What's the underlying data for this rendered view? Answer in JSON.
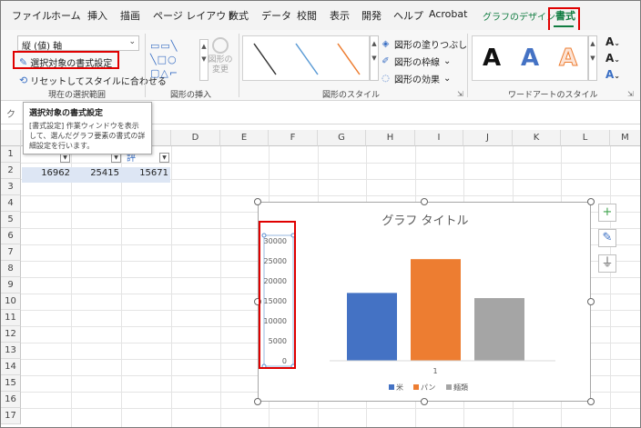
{
  "menu": {
    "tabs": [
      {
        "label": "ファイル"
      },
      {
        "label": "ホーム"
      },
      {
        "label": "挿入"
      },
      {
        "label": "描画"
      },
      {
        "label": "ページ レイアウト"
      },
      {
        "label": "数式"
      },
      {
        "label": "データ"
      },
      {
        "label": "校閲"
      },
      {
        "label": "表示"
      },
      {
        "label": "開発"
      },
      {
        "label": "ヘルプ"
      },
      {
        "label": "Acrobat"
      },
      {
        "label": "グラフのデザイン"
      },
      {
        "label": "書式"
      }
    ],
    "active_tab": "書式"
  },
  "ribbon": {
    "selection_group": {
      "element_combo": "縦 (値) 軸",
      "format_selection": "選択対象の書式設定",
      "reset_style": "リセットしてスタイルに合わせる",
      "label": "現在の選択範囲"
    },
    "insert_shapes": {
      "change_shape": "図形の変更",
      "label": "図形の挿入"
    },
    "shape_styles": {
      "fill": "図形の塗りつぶし",
      "outline": "図形の枠線",
      "effects": "図形の効果",
      "label": "図形のスタイル",
      "colors": {
        "line1": "#333333",
        "line2": "#5b9bd5",
        "line3": "#ed7d31"
      }
    },
    "wordart": {
      "letters": [
        "A",
        "A",
        "A"
      ],
      "label": "ワードアートのスタイル",
      "colors": {
        "letter1": "#111111",
        "letter2": "#4472c4",
        "letter3": "#ed7d31"
      }
    }
  },
  "tooltip": {
    "title": "選択対象の書式設定",
    "body": "[書式設定] 作業ウィンドウを表示して、選んだグラフ要素の書式の詳細設定を行います。"
  },
  "sheet": {
    "columns": [
      "D",
      "E",
      "F",
      "G",
      "H",
      "I",
      "J",
      "K",
      "L",
      "M"
    ],
    "rows": [
      "1",
      "2",
      "3",
      "4",
      "5",
      "6",
      "7",
      "8",
      "9",
      "10",
      "11",
      "12",
      "13",
      "14",
      "15",
      "16",
      "17"
    ],
    "header_fragment": "評",
    "row2_values": [
      "16962",
      "25415",
      "15671"
    ]
  },
  "chart_data": {
    "type": "bar",
    "title": "グラフ タイトル",
    "categories": [
      "1"
    ],
    "series": [
      {
        "name": "米",
        "values": [
          16962
        ],
        "color": "#4472c4"
      },
      {
        "name": "パン",
        "values": [
          25415
        ],
        "color": "#ed7d31"
      },
      {
        "name": "麺類",
        "values": [
          15671
        ],
        "color": "#a5a5a5"
      }
    ],
    "ylim": [
      0,
      30000
    ],
    "yticks": [
      "30000",
      "25000",
      "20000",
      "15000",
      "10000",
      "5000",
      "0"
    ],
    "legend": "bottom",
    "grid": false
  }
}
